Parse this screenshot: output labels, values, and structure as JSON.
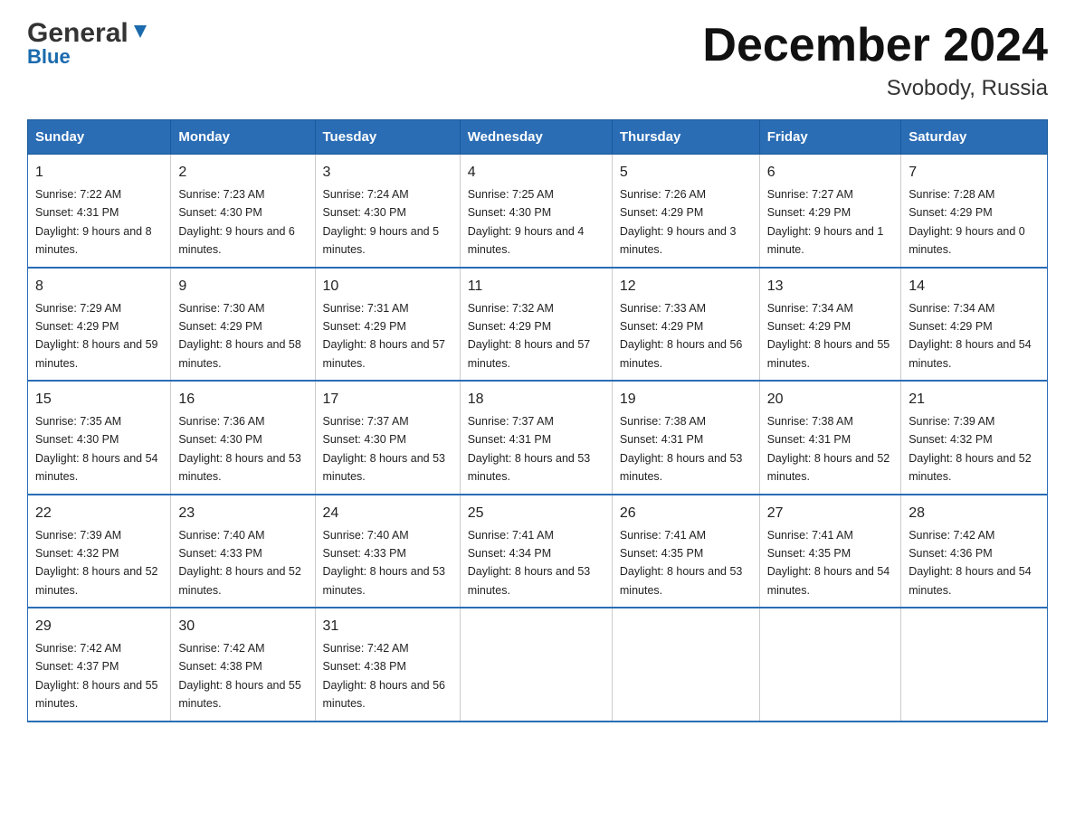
{
  "header": {
    "logo_general": "General",
    "logo_blue": "Blue",
    "title": "December 2024",
    "subtitle": "Svobody, Russia"
  },
  "columns": [
    "Sunday",
    "Monday",
    "Tuesday",
    "Wednesday",
    "Thursday",
    "Friday",
    "Saturday"
  ],
  "weeks": [
    [
      {
        "day": "1",
        "sunrise": "7:22 AM",
        "sunset": "4:31 PM",
        "daylight": "9 hours and 8 minutes."
      },
      {
        "day": "2",
        "sunrise": "7:23 AM",
        "sunset": "4:30 PM",
        "daylight": "9 hours and 6 minutes."
      },
      {
        "day": "3",
        "sunrise": "7:24 AM",
        "sunset": "4:30 PM",
        "daylight": "9 hours and 5 minutes."
      },
      {
        "day": "4",
        "sunrise": "7:25 AM",
        "sunset": "4:30 PM",
        "daylight": "9 hours and 4 minutes."
      },
      {
        "day": "5",
        "sunrise": "7:26 AM",
        "sunset": "4:29 PM",
        "daylight": "9 hours and 3 minutes."
      },
      {
        "day": "6",
        "sunrise": "7:27 AM",
        "sunset": "4:29 PM",
        "daylight": "9 hours and 1 minute."
      },
      {
        "day": "7",
        "sunrise": "7:28 AM",
        "sunset": "4:29 PM",
        "daylight": "9 hours and 0 minutes."
      }
    ],
    [
      {
        "day": "8",
        "sunrise": "7:29 AM",
        "sunset": "4:29 PM",
        "daylight": "8 hours and 59 minutes."
      },
      {
        "day": "9",
        "sunrise": "7:30 AM",
        "sunset": "4:29 PM",
        "daylight": "8 hours and 58 minutes."
      },
      {
        "day": "10",
        "sunrise": "7:31 AM",
        "sunset": "4:29 PM",
        "daylight": "8 hours and 57 minutes."
      },
      {
        "day": "11",
        "sunrise": "7:32 AM",
        "sunset": "4:29 PM",
        "daylight": "8 hours and 57 minutes."
      },
      {
        "day": "12",
        "sunrise": "7:33 AM",
        "sunset": "4:29 PM",
        "daylight": "8 hours and 56 minutes."
      },
      {
        "day": "13",
        "sunrise": "7:34 AM",
        "sunset": "4:29 PM",
        "daylight": "8 hours and 55 minutes."
      },
      {
        "day": "14",
        "sunrise": "7:34 AM",
        "sunset": "4:29 PM",
        "daylight": "8 hours and 54 minutes."
      }
    ],
    [
      {
        "day": "15",
        "sunrise": "7:35 AM",
        "sunset": "4:30 PM",
        "daylight": "8 hours and 54 minutes."
      },
      {
        "day": "16",
        "sunrise": "7:36 AM",
        "sunset": "4:30 PM",
        "daylight": "8 hours and 53 minutes."
      },
      {
        "day": "17",
        "sunrise": "7:37 AM",
        "sunset": "4:30 PM",
        "daylight": "8 hours and 53 minutes."
      },
      {
        "day": "18",
        "sunrise": "7:37 AM",
        "sunset": "4:31 PM",
        "daylight": "8 hours and 53 minutes."
      },
      {
        "day": "19",
        "sunrise": "7:38 AM",
        "sunset": "4:31 PM",
        "daylight": "8 hours and 53 minutes."
      },
      {
        "day": "20",
        "sunrise": "7:38 AM",
        "sunset": "4:31 PM",
        "daylight": "8 hours and 52 minutes."
      },
      {
        "day": "21",
        "sunrise": "7:39 AM",
        "sunset": "4:32 PM",
        "daylight": "8 hours and 52 minutes."
      }
    ],
    [
      {
        "day": "22",
        "sunrise": "7:39 AM",
        "sunset": "4:32 PM",
        "daylight": "8 hours and 52 minutes."
      },
      {
        "day": "23",
        "sunrise": "7:40 AM",
        "sunset": "4:33 PM",
        "daylight": "8 hours and 52 minutes."
      },
      {
        "day": "24",
        "sunrise": "7:40 AM",
        "sunset": "4:33 PM",
        "daylight": "8 hours and 53 minutes."
      },
      {
        "day": "25",
        "sunrise": "7:41 AM",
        "sunset": "4:34 PM",
        "daylight": "8 hours and 53 minutes."
      },
      {
        "day": "26",
        "sunrise": "7:41 AM",
        "sunset": "4:35 PM",
        "daylight": "8 hours and 53 minutes."
      },
      {
        "day": "27",
        "sunrise": "7:41 AM",
        "sunset": "4:35 PM",
        "daylight": "8 hours and 54 minutes."
      },
      {
        "day": "28",
        "sunrise": "7:42 AM",
        "sunset": "4:36 PM",
        "daylight": "8 hours and 54 minutes."
      }
    ],
    [
      {
        "day": "29",
        "sunrise": "7:42 AM",
        "sunset": "4:37 PM",
        "daylight": "8 hours and 55 minutes."
      },
      {
        "day": "30",
        "sunrise": "7:42 AM",
        "sunset": "4:38 PM",
        "daylight": "8 hours and 55 minutes."
      },
      {
        "day": "31",
        "sunrise": "7:42 AM",
        "sunset": "4:38 PM",
        "daylight": "8 hours and 56 minutes."
      },
      null,
      null,
      null,
      null
    ]
  ]
}
